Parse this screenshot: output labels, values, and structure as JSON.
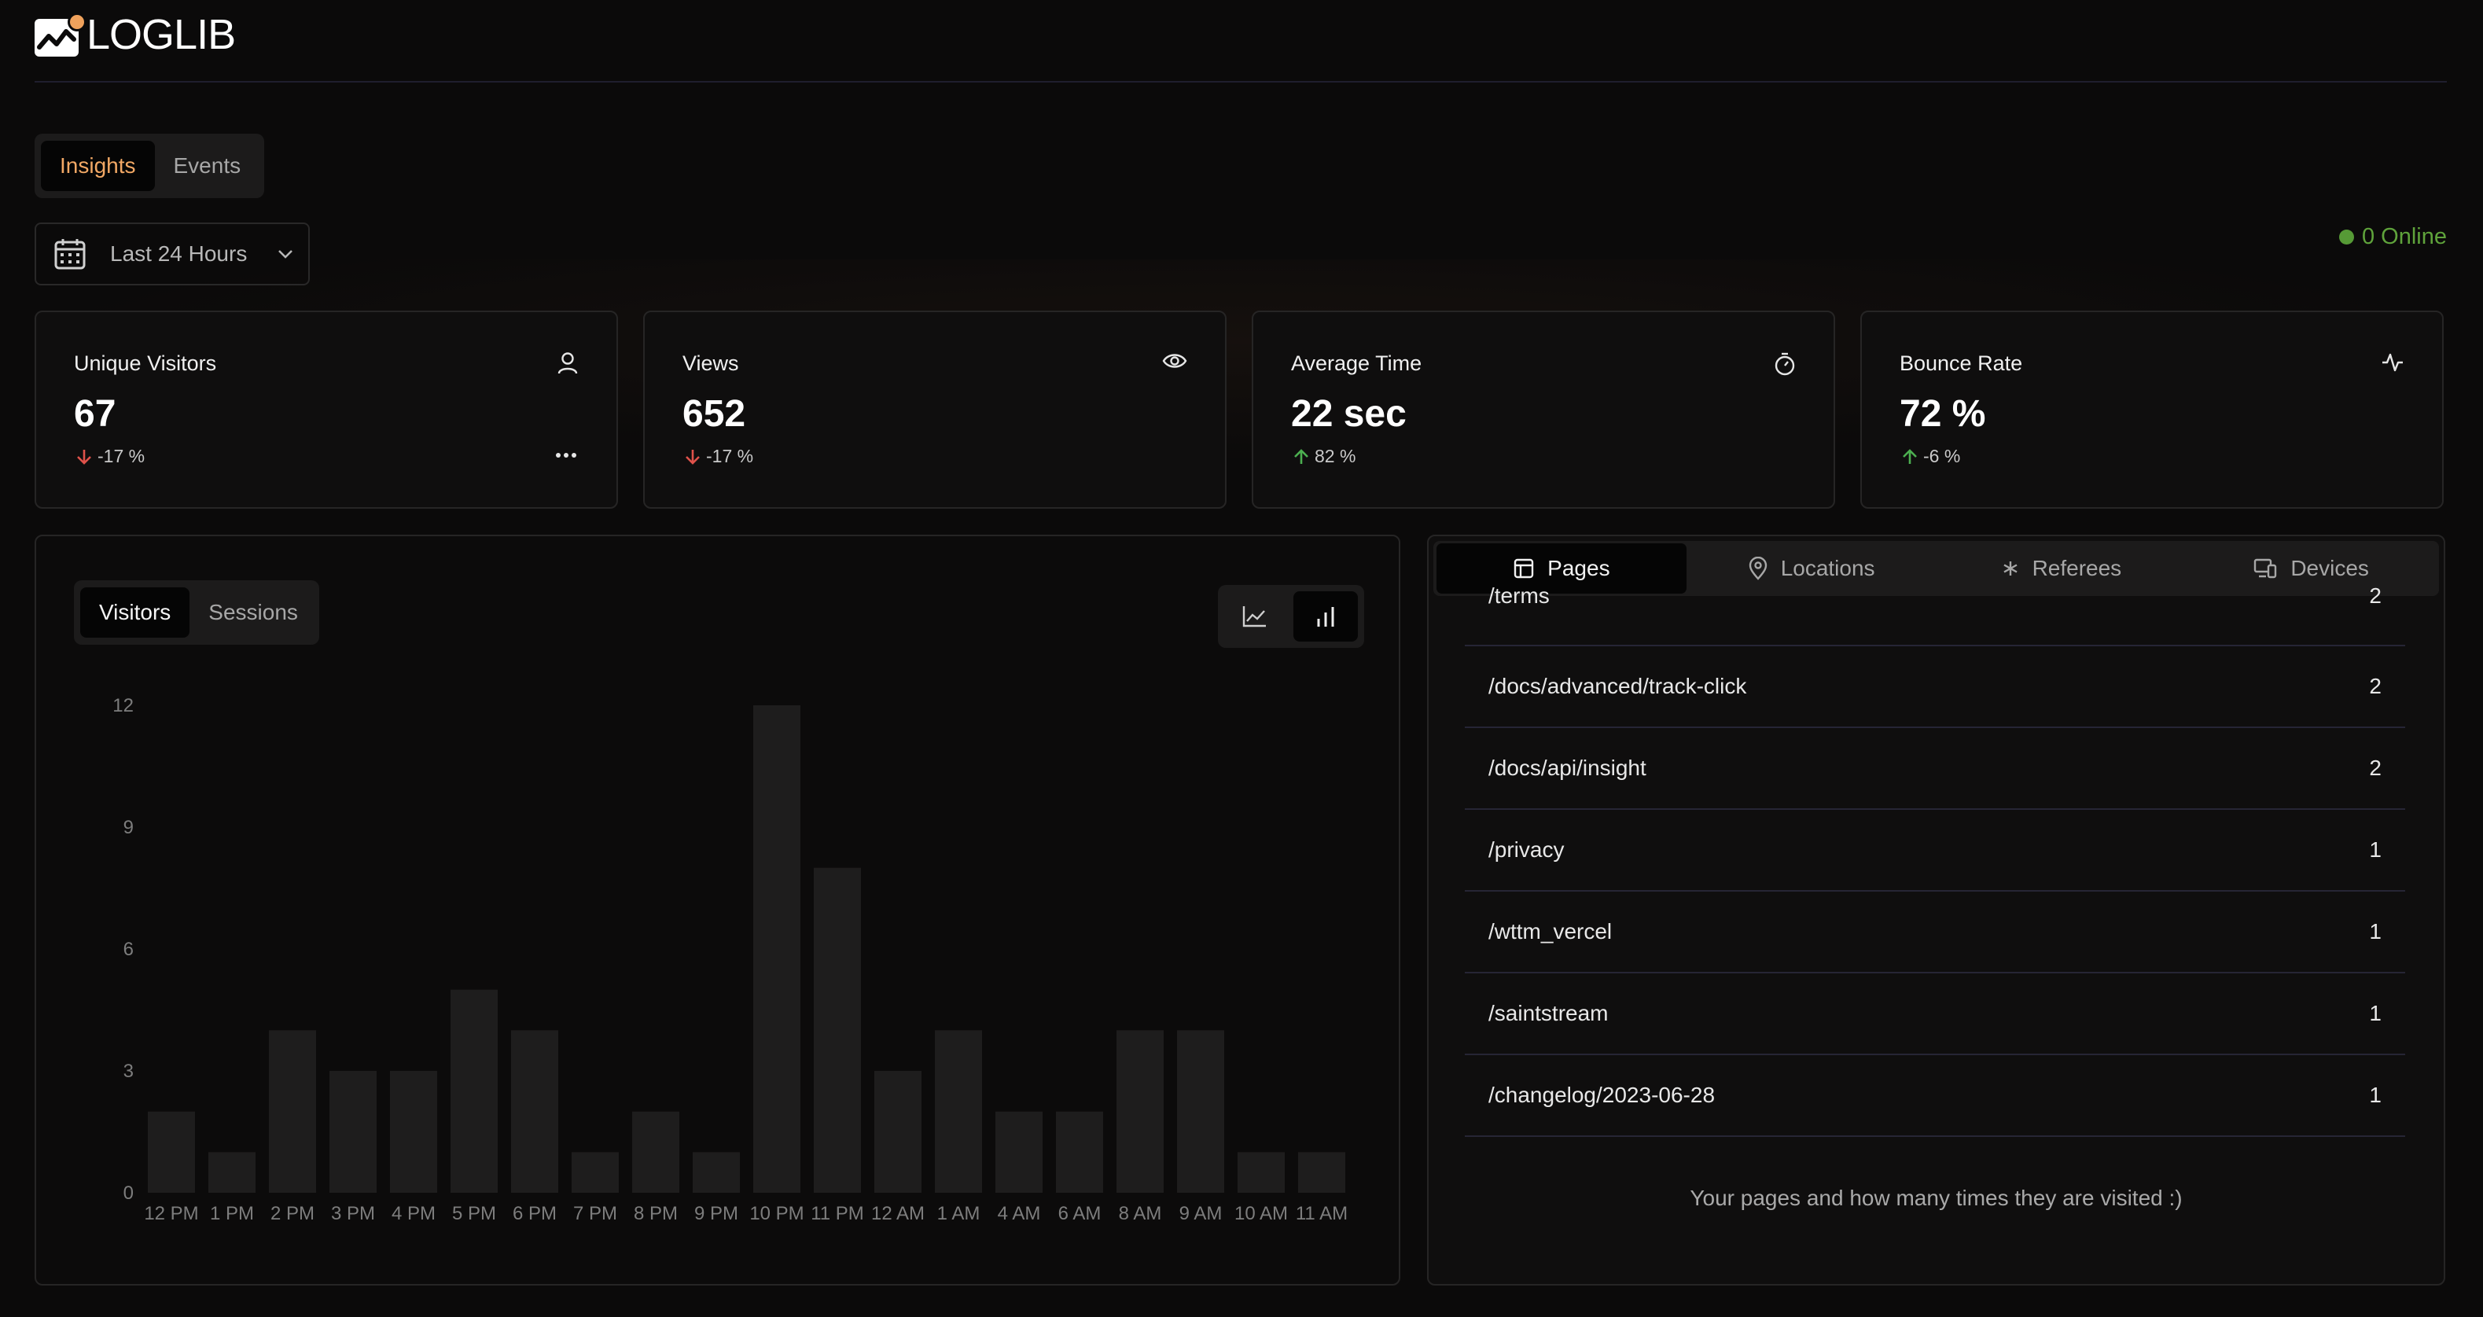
{
  "brand": {
    "name": "LOGLIB"
  },
  "tabs": [
    {
      "label": "Insights",
      "active": true
    },
    {
      "label": "Events",
      "active": false
    }
  ],
  "date_range": {
    "label": "Last 24 Hours"
  },
  "online": {
    "label": "0 Online",
    "color": "#5fa33b"
  },
  "stats": [
    {
      "title": "Unique Visitors",
      "icon": "user-icon",
      "value": "67",
      "change": "-17 %",
      "direction": "down"
    },
    {
      "title": "Views",
      "icon": "eye-icon",
      "value": "652",
      "change": "-17 %",
      "direction": "down"
    },
    {
      "title": "Average Time",
      "icon": "stopwatch-icon",
      "value": "22 sec",
      "change": "82 %",
      "direction": "up"
    },
    {
      "title": "Bounce Rate",
      "icon": "activity-icon",
      "value": "72 %",
      "change": "-6 %",
      "direction": "up"
    }
  ],
  "chart_panel": {
    "tabs": [
      {
        "label": "Visitors",
        "active": true
      },
      {
        "label": "Sessions",
        "active": false
      }
    ],
    "chart_types": [
      {
        "icon": "line-chart-icon",
        "active": false
      },
      {
        "icon": "bar-chart-icon",
        "active": true
      }
    ]
  },
  "chart_data": {
    "type": "bar",
    "categories": [
      "12 PM",
      "1 PM",
      "2 PM",
      "3 PM",
      "4 PM",
      "5 PM",
      "6 PM",
      "7 PM",
      "8 PM",
      "9 PM",
      "10 PM",
      "11 PM",
      "12 AM",
      "1 AM",
      "4 AM",
      "6 AM",
      "8 AM",
      "9 AM",
      "10 AM",
      "11 AM"
    ],
    "values": [
      2,
      1,
      4,
      3,
      3,
      5,
      4,
      1,
      2,
      1,
      12,
      8,
      3,
      4,
      2,
      2,
      4,
      4,
      1,
      1
    ],
    "yticks": [
      0,
      3,
      6,
      9,
      12
    ],
    "ylim": [
      0,
      12
    ],
    "grid": false,
    "bar_color": "#1e1d1d"
  },
  "table_panel": {
    "tabs": [
      {
        "label": "Pages",
        "icon": "page-icon",
        "active": true
      },
      {
        "label": "Locations",
        "icon": "location-pin-icon",
        "active": false
      },
      {
        "label": "Referees",
        "icon": "asterisk-icon",
        "active": false
      },
      {
        "label": "Devices",
        "icon": "devices-icon",
        "active": false
      }
    ],
    "rows": [
      {
        "path": "/terms",
        "count": "2"
      },
      {
        "path": "/docs/advanced/track-click",
        "count": "2"
      },
      {
        "path": "/docs/api/insight",
        "count": "2"
      },
      {
        "path": "/privacy",
        "count": "1"
      },
      {
        "path": "/wttm_vercel",
        "count": "1"
      },
      {
        "path": "/saintstream",
        "count": "1"
      },
      {
        "path": "/changelog/2023-06-28",
        "count": "1"
      }
    ],
    "footer": "Your pages and how many times they are visited :)"
  },
  "colors": {
    "accent": "#f2a865",
    "down": "#e0524a",
    "up": "#4caf50"
  }
}
